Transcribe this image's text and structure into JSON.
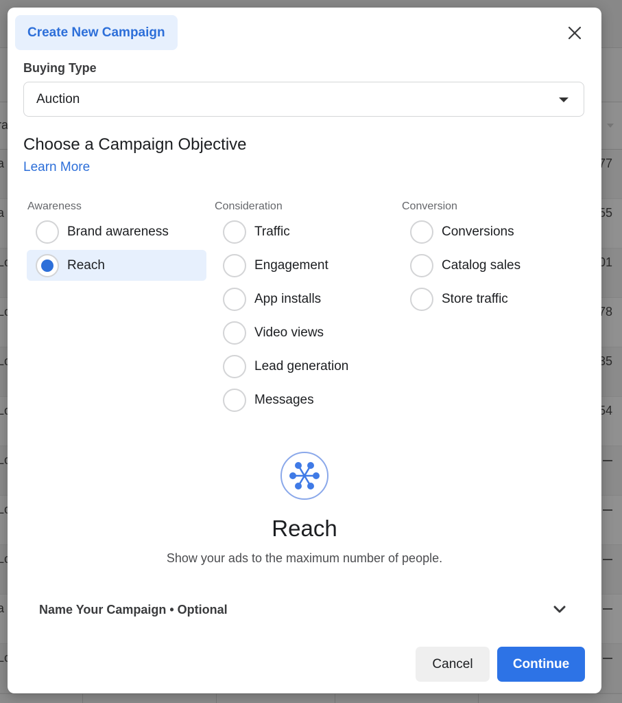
{
  "background": {
    "left_fragments": [
      "ra",
      "a",
      "a",
      "Lo",
      "Lo",
      "Lo",
      "Lo",
      "Lo",
      "Lo",
      "Lo",
      "a",
      "Lo"
    ],
    "right_fragments": [
      "77",
      "55",
      "01",
      "78",
      "35",
      "54"
    ]
  },
  "modal": {
    "title": "Create New Campaign",
    "close_icon": "close-icon",
    "buying_type": {
      "label": "Buying Type",
      "selected": "Auction"
    },
    "objective": {
      "title": "Choose a Campaign Objective",
      "learn_more": "Learn More",
      "columns": [
        {
          "heading": "Awareness",
          "options": [
            {
              "label": "Brand awareness",
              "selected": false
            },
            {
              "label": "Reach",
              "selected": true
            }
          ]
        },
        {
          "heading": "Consideration",
          "options": [
            {
              "label": "Traffic",
              "selected": false
            },
            {
              "label": "Engagement",
              "selected": false
            },
            {
              "label": "App installs",
              "selected": false
            },
            {
              "label": "Video views",
              "selected": false
            },
            {
              "label": "Lead generation",
              "selected": false
            },
            {
              "label": "Messages",
              "selected": false
            }
          ]
        },
        {
          "heading": "Conversion",
          "options": [
            {
              "label": "Conversions",
              "selected": false
            },
            {
              "label": "Catalog sales",
              "selected": false
            },
            {
              "label": "Store traffic",
              "selected": false
            }
          ]
        }
      ]
    },
    "detail": {
      "icon": "reach-network-icon",
      "title": "Reach",
      "description": "Show your ads to the maximum number of people."
    },
    "name_section": {
      "label": "Name Your Campaign • Optional"
    },
    "buttons": {
      "cancel": "Cancel",
      "continue": "Continue"
    },
    "colors": {
      "accent": "#2d6fd9",
      "selected_bg": "#e7f0fd",
      "continue_bg": "#2d73e6"
    }
  }
}
